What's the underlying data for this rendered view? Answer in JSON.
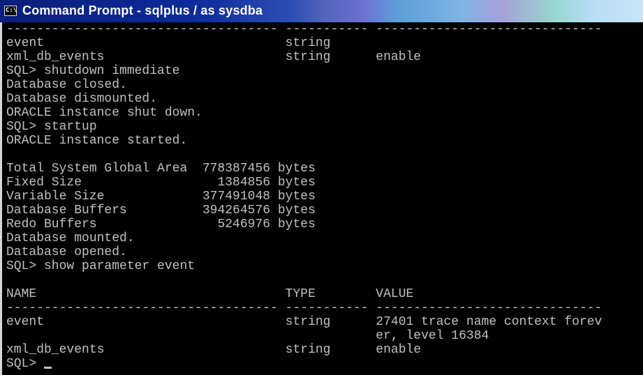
{
  "window": {
    "title": "Command Prompt - sqlplus / as sysdba",
    "icon_name": "cmd-icon",
    "icon_label": "C:\\"
  },
  "console": {
    "lines": [
      "------------------------------------ ----------- ------------------------------",
      "event                                string",
      "xml_db_events                        string      enable",
      "SQL> shutdown immediate",
      "Database closed.",
      "Database dismounted.",
      "ORACLE instance shut down.",
      "SQL> startup",
      "ORACLE instance started.",
      "",
      "Total System Global Area  778387456 bytes",
      "Fixed Size                  1384856 bytes",
      "Variable Size             377491048 bytes",
      "Database Buffers          394264576 bytes",
      "Redo Buffers                5246976 bytes",
      "Database mounted.",
      "Database opened.",
      "SQL> show parameter event",
      "",
      "NAME                                 TYPE        VALUE",
      "------------------------------------ ----------- ------------------------------",
      "event                                string      27401 trace name context forev",
      "                                                 er, level 16384",
      "xml_db_events                        string      enable"
    ],
    "prompt": "SQL> "
  }
}
